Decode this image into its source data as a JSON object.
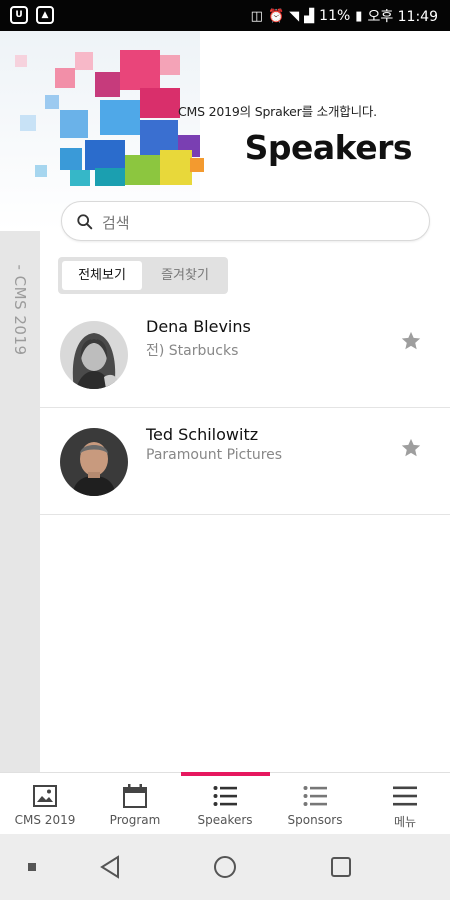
{
  "status_bar": {
    "battery": "11%",
    "time": "오후 11:49"
  },
  "header": {
    "subtitle": "CMS 2019의 Spraker를 소개합니다.",
    "title": "Speakers",
    "side_label": "- CMS 2019"
  },
  "search": {
    "placeholder": "검색"
  },
  "filter": {
    "all_label": "전체보기",
    "favorites_label": "즐겨찾기"
  },
  "speakers": [
    {
      "name": "Dena Blevins",
      "org": "전) Starbucks"
    },
    {
      "name": "Ted Schilowitz",
      "org": "Paramount Pictures"
    }
  ],
  "tabs": [
    {
      "label": "CMS 2019",
      "icon": "image-icon"
    },
    {
      "label": "Program",
      "icon": "calendar-icon"
    },
    {
      "label": "Speakers",
      "icon": "list-icon"
    },
    {
      "label": "Sponsors",
      "icon": "list-icon"
    },
    {
      "label": "메뉴",
      "icon": "menu-icon"
    }
  ],
  "colors": {
    "accent": "#e6185f",
    "star": "#9e9e9e",
    "side_strip": "#e6e6e6"
  }
}
